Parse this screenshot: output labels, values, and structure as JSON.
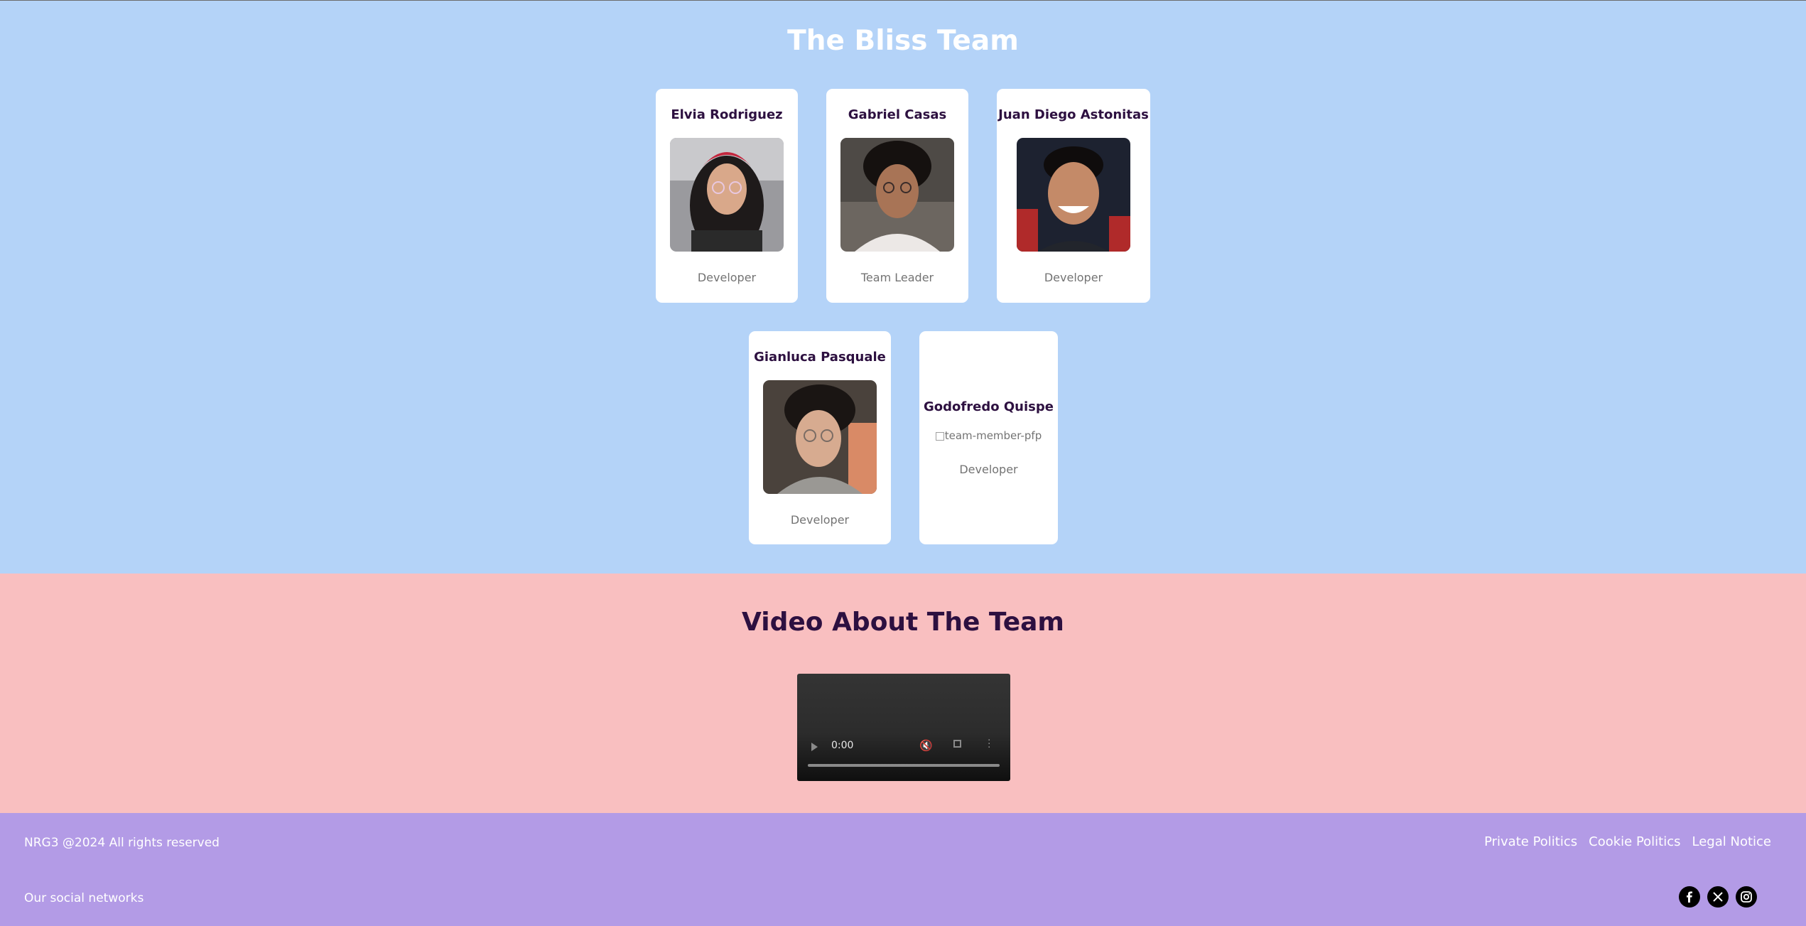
{
  "team": {
    "title": "The Bliss Team",
    "members": [
      {
        "name": "Elvia Rodriguez",
        "role": "Developer"
      },
      {
        "name": "Gabriel Casas",
        "role": "Team Leader"
      },
      {
        "name": "Juan Diego Astonitas",
        "role": "Developer"
      },
      {
        "name": "Gianluca Pasquale",
        "role": "Developer"
      },
      {
        "name": "Godofredo Quispe",
        "role": "Developer",
        "image_alt": "team-member-pfp"
      }
    ]
  },
  "video": {
    "title": "Video About The Team",
    "time": "0:00"
  },
  "footer": {
    "copyright": "NRG3 @2024 All rights reserved",
    "social_label": "Our social networks",
    "links": [
      "Private Politics",
      "Cookie Politics",
      "Legal Notice"
    ],
    "social_icons": [
      "facebook-icon",
      "x-icon",
      "instagram-icon"
    ]
  }
}
